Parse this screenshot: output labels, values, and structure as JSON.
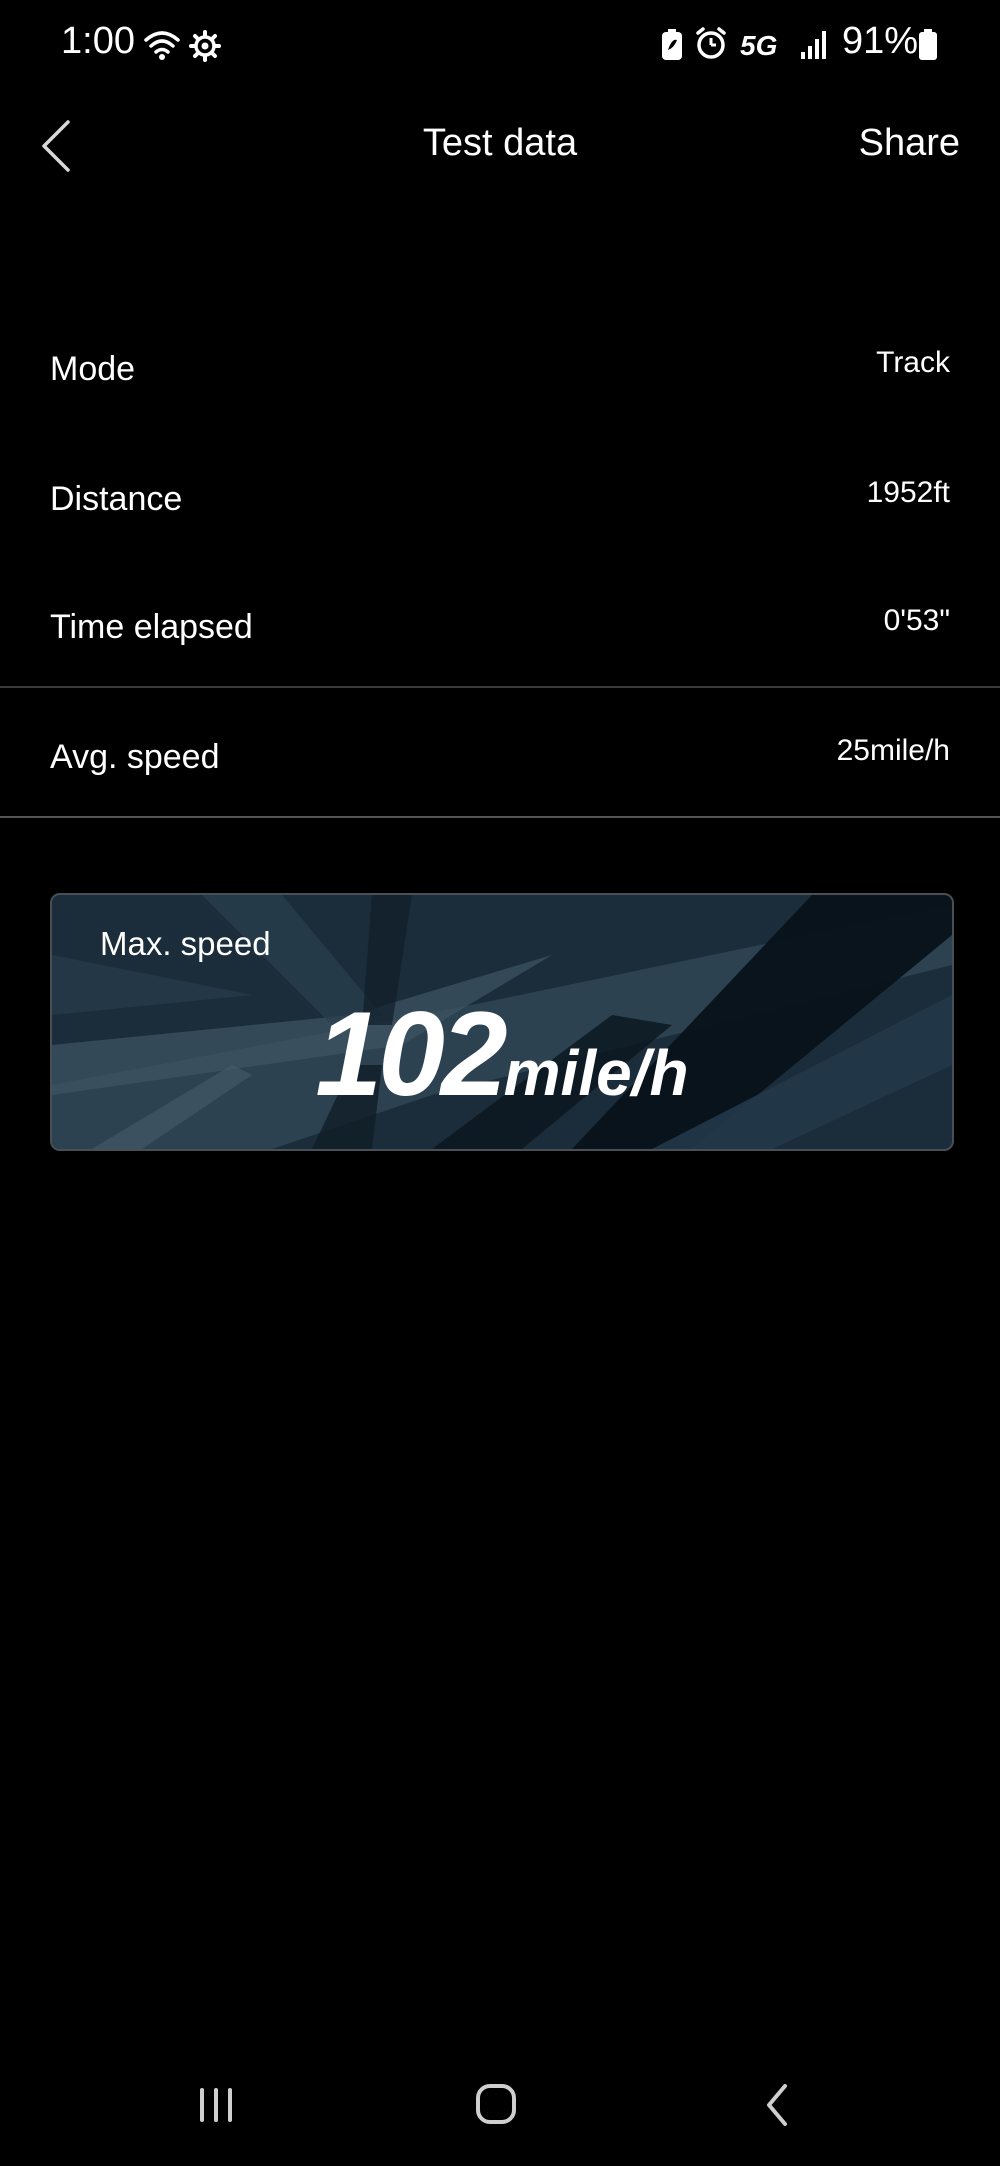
{
  "status_bar": {
    "time": "1:00",
    "network": "5G",
    "battery": "91%",
    "icons": [
      "wifi-icon",
      "settings-icon",
      "battery-saver-icon",
      "alarm-icon",
      "signal-icon",
      "battery-icon"
    ]
  },
  "header": {
    "title": "Test data",
    "share_label": "Share",
    "back_icon": "chevron-left-icon"
  },
  "rows": [
    {
      "label": "Mode",
      "value": "Track"
    },
    {
      "label": "Distance",
      "value": "1952ft"
    },
    {
      "label": "Time elapsed",
      "value": "0'53\""
    },
    {
      "label": "Avg. speed",
      "value": "25mile/h"
    }
  ],
  "max_speed": {
    "label": "Max. speed",
    "value": "102",
    "unit": "mile/h"
  },
  "nav_bar": {
    "icons": [
      "recent-apps-icon",
      "home-icon",
      "back-icon"
    ]
  },
  "colors": {
    "background": "#000000",
    "text": "#ffffff",
    "divider": "#3a3a3a",
    "card_base": "#1d2f3c"
  }
}
